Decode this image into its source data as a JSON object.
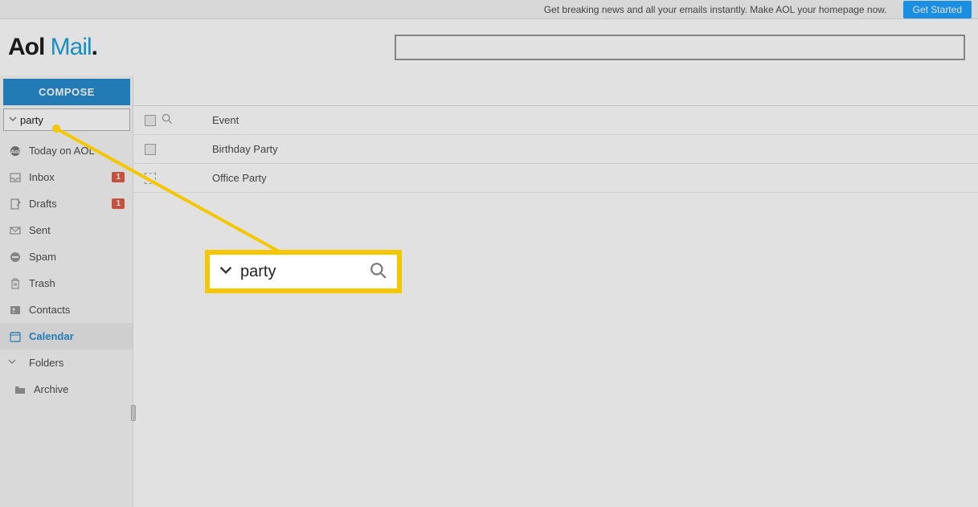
{
  "banner": {
    "message": "Get breaking news and all your emails instantly. Make AOL your homepage now.",
    "button": "Get Started"
  },
  "logo": {
    "part1": "Aol",
    "part2": " Mail",
    "dot": "."
  },
  "compose_label": "COMPOSE",
  "side_search": {
    "value": "party"
  },
  "nav": {
    "today": "Today on AOL",
    "inbox": {
      "label": "Inbox",
      "badge": "1"
    },
    "drafts": {
      "label": "Drafts",
      "badge": "1"
    },
    "sent": "Sent",
    "spam": "Spam",
    "trash": "Trash",
    "contacts": "Contacts",
    "calendar": "Calendar",
    "folders": "Folders",
    "archive": "Archive"
  },
  "events": {
    "header": "Event",
    "rows": [
      "Birthday Party",
      "Office Party"
    ]
  },
  "callout": {
    "value": "party"
  }
}
